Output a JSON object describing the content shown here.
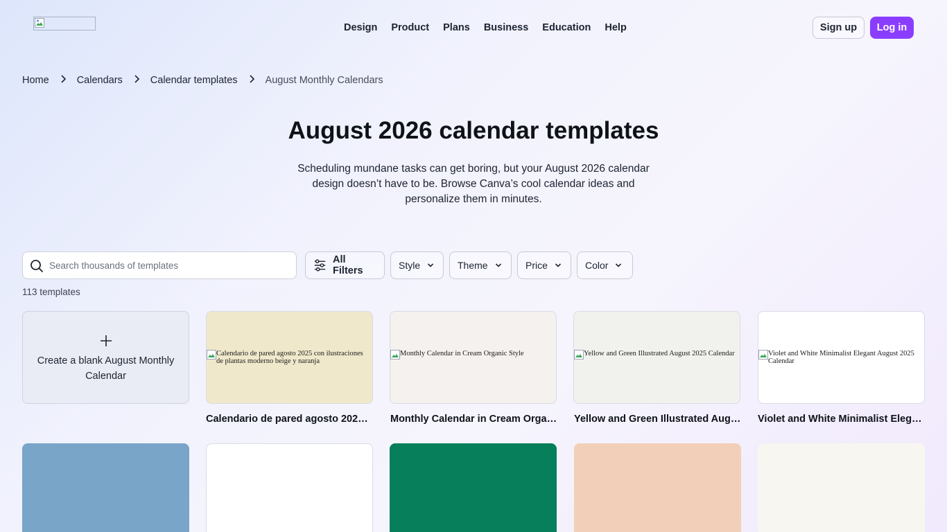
{
  "header": {
    "logo_alt": "",
    "nav": [
      "Design",
      "Product",
      "Plans",
      "Business",
      "Education",
      "Help"
    ],
    "signup_label": "Sign up",
    "login_label": "Log in"
  },
  "breadcrumb": {
    "items": [
      "Home",
      "Calendars",
      "Calendar templates"
    ],
    "current": "August Monthly Calendars"
  },
  "page": {
    "title": "August 2026 calendar templates",
    "subtitle": "Scheduling mundane tasks can get boring, but your August 2026 calendar design doesn’t have to be. Browse Canva’s cool calendar ideas and personalize them in minutes."
  },
  "search": {
    "placeholder": "Search thousands of templates",
    "value": ""
  },
  "filters": {
    "all": "All Filters",
    "style": "Style",
    "theme": "Theme",
    "price": "Price",
    "color": "Color"
  },
  "results": {
    "count": "113 templates"
  },
  "blank_card": {
    "label": "Create a blank August Monthly Calendar"
  },
  "templates": [
    {
      "alt": "Calendario de pared agosto 2025 con ilustraciones de plantas moderno beige y naranja",
      "caption": "Calendario de pared agosto 2025 con ilustraciones de plantas moderno beige y naranja",
      "bg": "#efe8cb"
    },
    {
      "alt": "Monthly Calendar in Cream Organic Style",
      "caption": "Monthly Calendar in Cream Organic Style",
      "bg": "#f4f1ee"
    },
    {
      "alt": "Yellow and Green Illustrated August 2025 Calendar",
      "caption": "Yellow and Green Illustrated August 2025 Calendar",
      "bg": "#f1f2ee"
    },
    {
      "alt": "Violet and White Minimalist Elegant August 2025 Calendar",
      "caption": "Violet and White Minimalist Elegant August 2025 Calendar",
      "bg": "#ffffff"
    }
  ],
  "row2_colors": [
    "#78a5c8",
    "#ffffff",
    "#067f5a",
    "#f2cfb8",
    "#f8f6f1"
  ],
  "colors": {
    "accent": "#8b3dff"
  }
}
